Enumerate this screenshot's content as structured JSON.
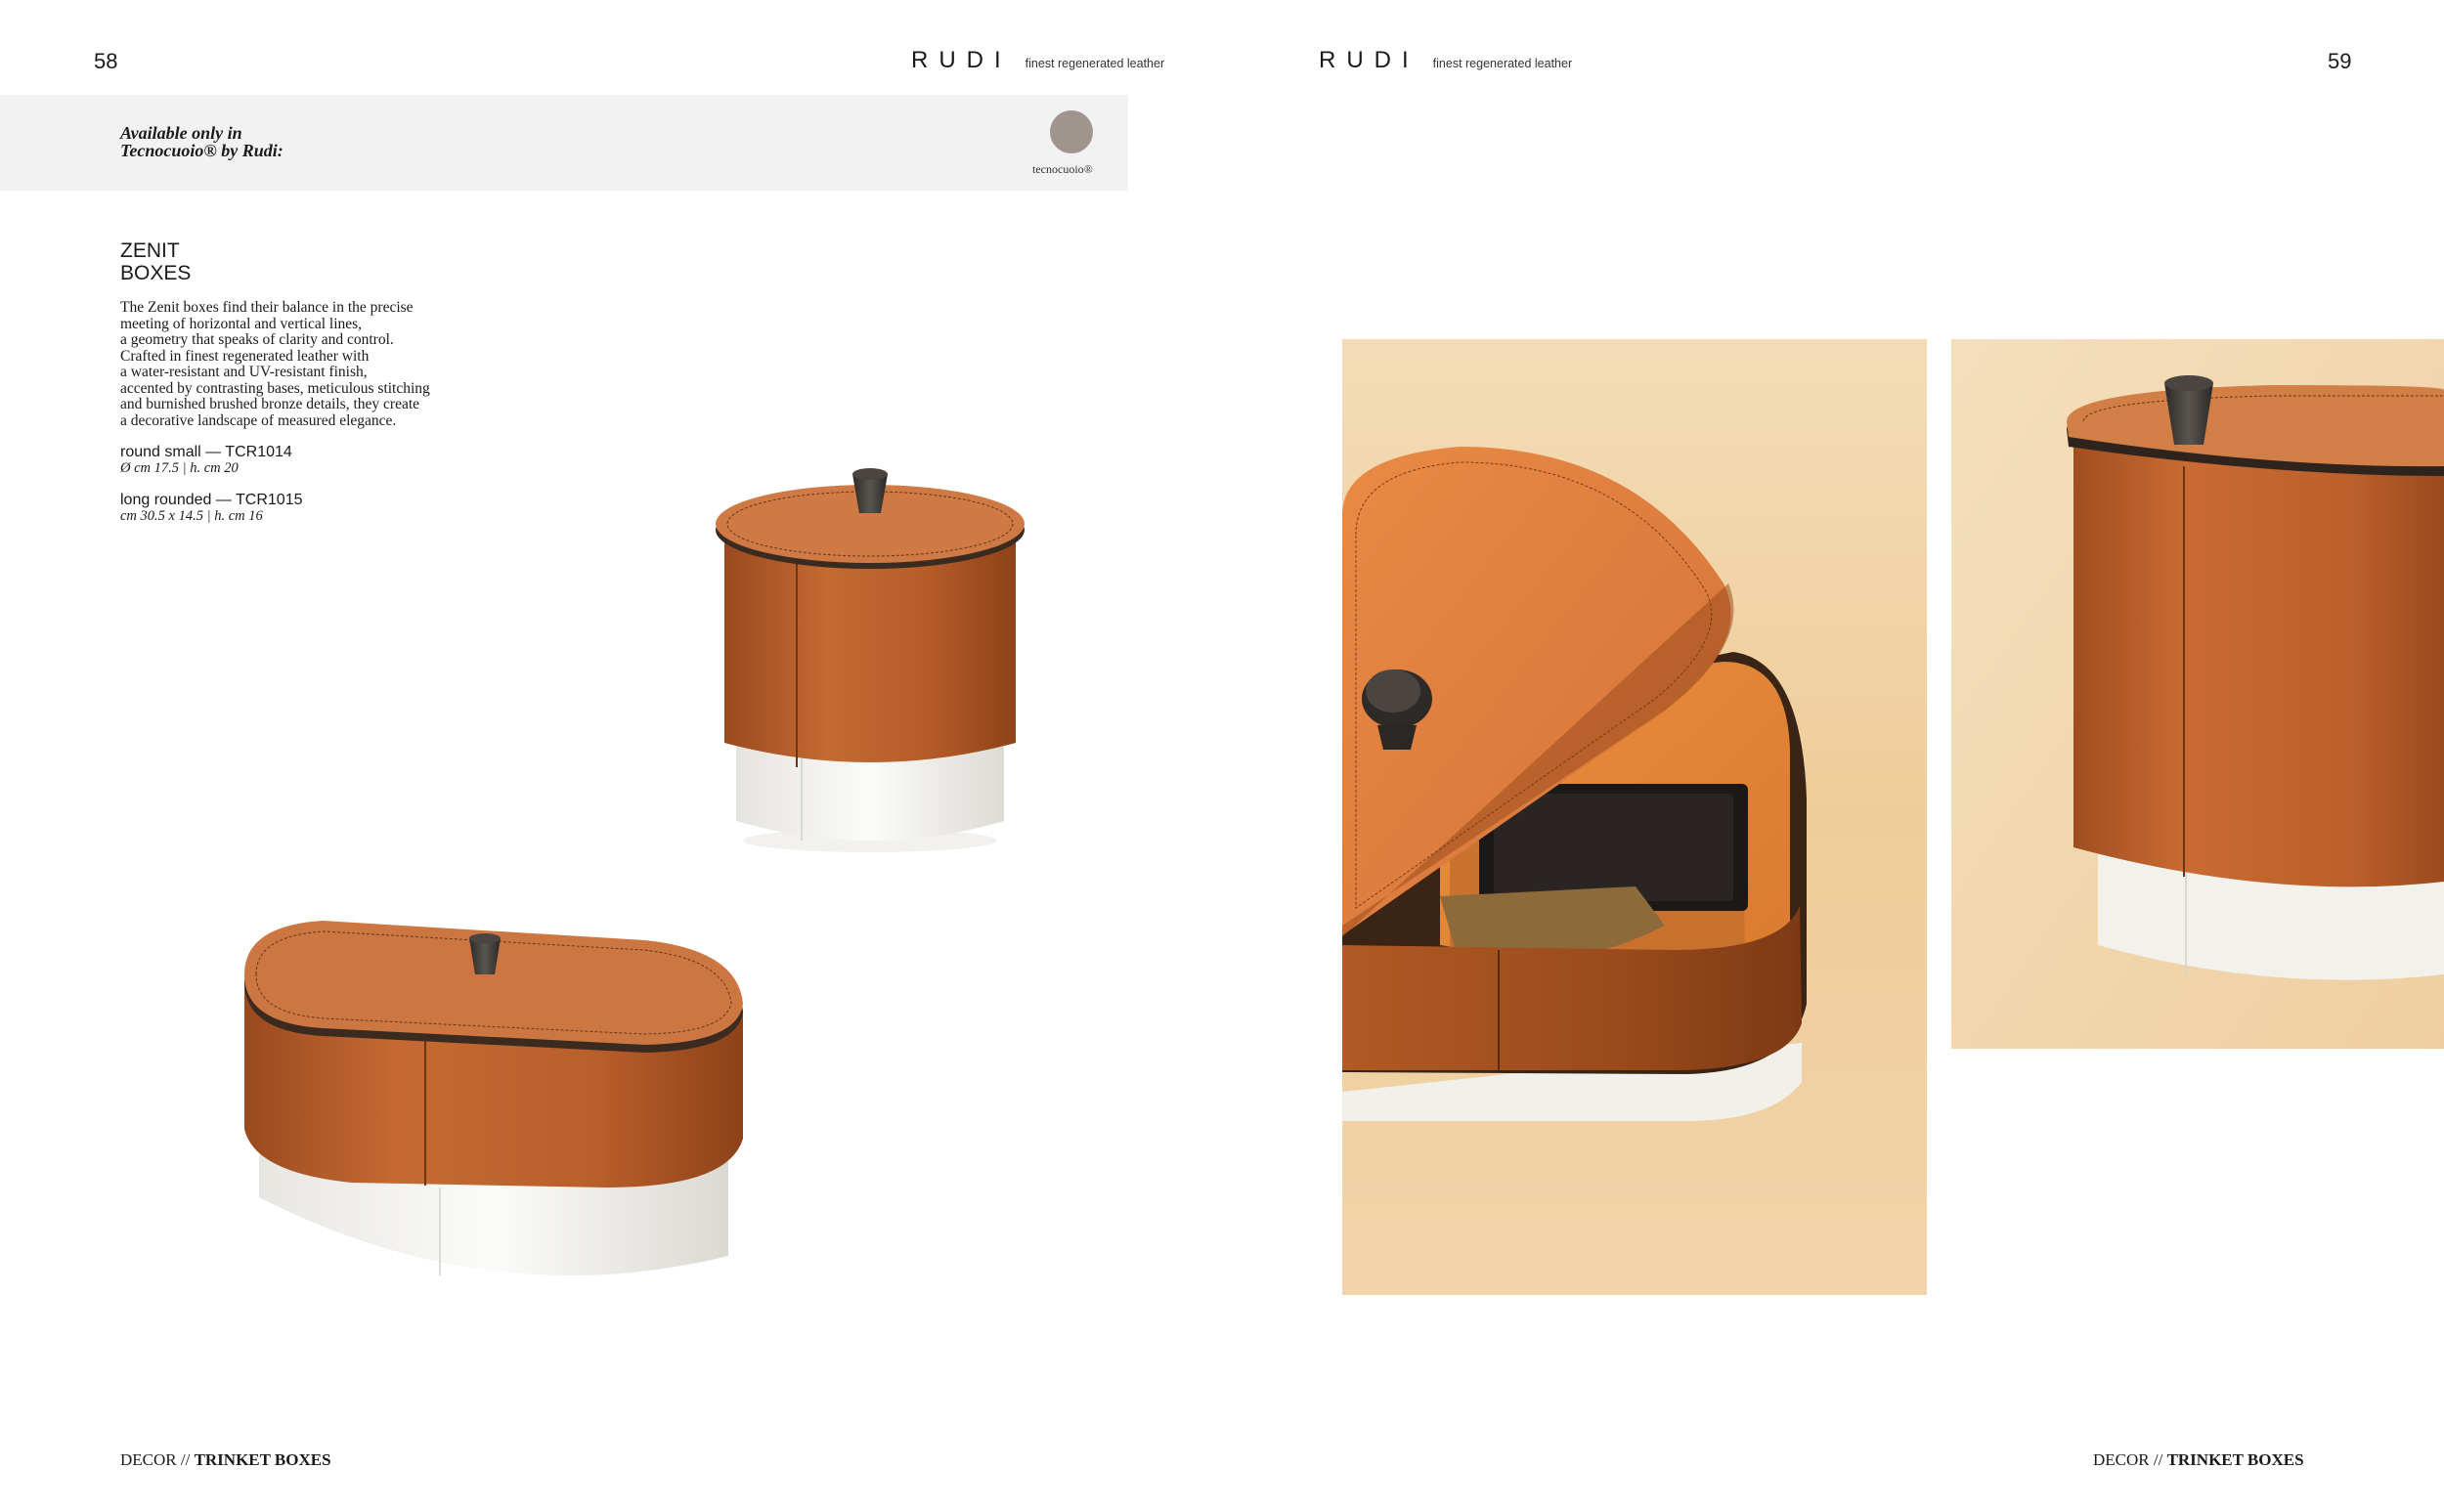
{
  "left_page": {
    "page_number": "58",
    "brand": {
      "logo": "RUDI",
      "tagline": "finest regenerated leather"
    },
    "availability": {
      "line1": "Available only in",
      "line2": "Tecnocuoio® by Rudi:",
      "swatch_label": "tecnocuoio®",
      "swatch_color": "#a0948f"
    },
    "product": {
      "title_line1": "ZENIT",
      "title_line2": "BOXES",
      "description": [
        "The Zenit boxes find their balance in the precise",
        "meeting of horizontal and vertical lines,",
        "a geometry that speaks of clarity and control.",
        "Crafted in finest regenerated leather with",
        "a water-resistant and UV-resistant finish,",
        "accented by contrasting bases, meticulous stitching",
        "and burnished brushed bronze details, they create",
        "a decorative landscape of measured elegance."
      ],
      "variants": [
        {
          "name": "round small — TCR1014",
          "dimensions": "Ø cm 17.5 | h. cm 20"
        },
        {
          "name": "long rounded — TCR1015",
          "dimensions": "cm 30.5 x 14.5 | h. cm 16"
        }
      ]
    },
    "footer": {
      "section": "DECOR //",
      "category": "TRINKET BOXES"
    }
  },
  "right_page": {
    "page_number": "59",
    "brand": {
      "logo": "RUDI",
      "tagline": "finest regenerated leather"
    },
    "footer": {
      "section": "DECOR //",
      "category": "TRINKET BOXES"
    }
  },
  "colors": {
    "leather": "#b5612c",
    "leather_light": "#d47e44",
    "base_white": "#efeeea",
    "knob": "#3b3835",
    "backdrop": "#f0d2a6"
  }
}
